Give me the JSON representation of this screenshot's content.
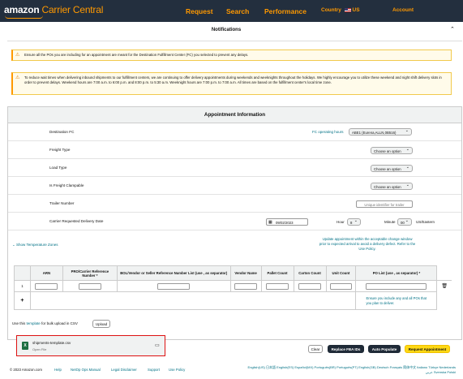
{
  "header": {
    "logo_main": "amazon",
    "logo_sub": "Carrier Central",
    "nav": [
      "Request",
      "Search",
      "Performance"
    ],
    "country_label": "Country",
    "country_value": "US",
    "account_label": "Account"
  },
  "notifications": {
    "title": "Notifications",
    "alert1": "Ensure all the POs you are including for an appointment are meant for the Destination Fulfillment Center (FC) you selected to prevent any delays.",
    "alert2": "To reduce wait times when delivering inbound shipments to our fulfillment centers, we are continuing to offer delivery appointments during weekends and weeknights throughout the holidays. We highly encourage you to utilize these weekend and night shift delivery slots in order to prevent delays. Weekend hours are 7:00 a.m. to 6:00 p.m. and 8:00 p.m. to 5:30 a.m. Weeknight hours are 7:00 p.m. to 7:00 a.m. All times are based on the fulfillment center's local time zone."
  },
  "appointment": {
    "title": "Appointment Information",
    "destination_label": "Destination FC",
    "fc_hours_link": "FC operating hours",
    "destination_value": "ABE1 (Eurena,ALLN,0B516)",
    "freight_type_label": "Freight Type",
    "freight_type_value": "Choose an option",
    "load_type_label": "Load Type",
    "load_type_value": "Choose an option",
    "clampable_label": "Is Freight Clampable",
    "clampable_value": "Choose an option",
    "trailer_label": "Trailer Number",
    "trailer_placeholder": "Unique identifier for trailer",
    "delivery_date_label": "Carrier Requested Delivery Date",
    "delivery_date_value": "09/02/2023",
    "hour_label": "Hour",
    "hour_value": "8",
    "minute_label": "Minute",
    "minute_value": "00",
    "timezone": "US/Eastern",
    "temp_zones_link": "Show Temperature Zones",
    "update_link": "Update appointment within the acceptable change window prior to expected arrival to avoid a delivery defect. Refer to the Use Policy."
  },
  "table": {
    "headers": [
      "ARN",
      "PRO/Carrier Reference Number *",
      "BOL/Vendor or Seller Reference Number List (use , as separator)",
      "Vendor Name",
      "Pallet Count",
      "Carton Count",
      "Unit Count",
      "PO List (use , as separator) *"
    ],
    "row_index": "1",
    "po_hint": "Ensure you include any and all POs that you plan to deliver.",
    "add_symbol": "+"
  },
  "upload": {
    "prefix": "Use this",
    "template_link": "template",
    "suffix": "for bulk upload in CSV",
    "button": "Upload",
    "file_name": "shipments-template.csv",
    "file_action": "Open File"
  },
  "actions": {
    "clear": "Clear",
    "replace": "Replace FBA IDs",
    "auto": "Auto Populate",
    "request": "Request Appointment"
  },
  "footer": {
    "copyright": "© 2023 Amazon.com",
    "links": [
      "Help",
      "NetOp Ops Manual",
      "Legal Disclaimer",
      "Support",
      "Use Policy"
    ],
    "languages": "English(US) 日本語 English(ES) Español(MX) Português(BR) Português(PT) English(GB) Deutsch Français 简体中文 Italiano Türkçe Nederlands عربي Svenska Polski"
  }
}
